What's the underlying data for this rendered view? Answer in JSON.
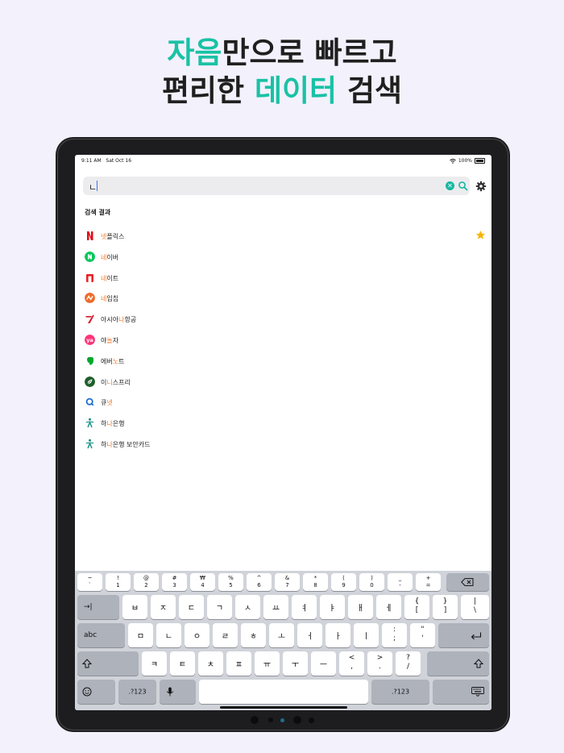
{
  "headline": {
    "line1_accent": "자음",
    "line1_rest": "만으로 빠르고",
    "line2_pre": "편리한 ",
    "line2_accent": "데이터",
    "line2_post": " 검색"
  },
  "colors": {
    "accent": "#19c2a5",
    "highlight": "#f07a2a",
    "star": "#f7b500"
  },
  "status_bar": {
    "time": "9:11 AM",
    "date": "Sat Oct 16",
    "battery": "100%"
  },
  "search": {
    "value": "ㄴ",
    "clear_icon": "clear-icon",
    "search_icon": "search-icon"
  },
  "settings_icon": "gear-icon",
  "results_title": "검색 결과",
  "results": [
    {
      "pre": "",
      "hl": "넷",
      "post": "플릭스",
      "icon": "netflix-icon",
      "starred": true
    },
    {
      "pre": "",
      "hl": "네",
      "post": "이버",
      "icon": "naver-icon"
    },
    {
      "pre": "",
      "hl": "네",
      "post": "이트",
      "icon": "nate-icon"
    },
    {
      "pre": "",
      "hl": "네",
      "post": "임칩",
      "icon": "namechip-icon"
    },
    {
      "pre": "아시아",
      "hl": "나",
      "post": "항공",
      "icon": "asiana-icon"
    },
    {
      "pre": "야",
      "hl": "놀",
      "post": "자",
      "icon": "yanolja-icon"
    },
    {
      "pre": "에버",
      "hl": "노",
      "post": "트",
      "icon": "evernote-icon"
    },
    {
      "pre": "이",
      "hl": "니",
      "post": "스프리",
      "icon": "innisfree-icon"
    },
    {
      "pre": "큐",
      "hl": "넷",
      "post": "",
      "icon": "qnet-icon"
    },
    {
      "pre": "하",
      "hl": "나",
      "post": "은행",
      "icon": "hanabank-icon"
    },
    {
      "pre": "하",
      "hl": "나",
      "post": "은행 보안카드",
      "icon": "hanabank-card-icon"
    }
  ],
  "keyboard": {
    "row1": [
      [
        "~",
        "`"
      ],
      [
        "!",
        "1"
      ],
      [
        "@",
        "2"
      ],
      [
        "#",
        "3"
      ],
      [
        "₩",
        "4"
      ],
      [
        "%",
        "5"
      ],
      [
        "^",
        "6"
      ],
      [
        "&",
        "7"
      ],
      [
        "*",
        "8"
      ],
      [
        "(",
        "9"
      ],
      [
        ")",
        "0"
      ],
      [
        "_",
        "-"
      ],
      [
        "+",
        "="
      ]
    ],
    "row2": [
      "ㅂ",
      "ㅈ",
      "ㄷ",
      "ㄱ",
      "ㅅ",
      "ㅛ",
      "ㅕ",
      "ㅑ",
      "ㅐ",
      "ㅔ"
    ],
    "row2_sym": [
      [
        "{",
        "["
      ],
      [
        "}",
        "]"
      ],
      [
        "|",
        "\\"
      ]
    ],
    "row3": [
      "ㅁ",
      "ㄴ",
      "ㅇ",
      "ㄹ",
      "ㅎ",
      "ㅗ",
      "ㅓ",
      "ㅏ",
      "ㅣ"
    ],
    "row3_sym": [
      [
        ":",
        ";"
      ],
      [
        "\"",
        "'"
      ]
    ],
    "row4": [
      "ㅋ",
      "ㅌ",
      "ㅊ",
      "ㅍ",
      "ㅠ",
      "ㅜ",
      "ㅡ"
    ],
    "row4_sym": [
      [
        "<",
        ","
      ],
      [
        ">",
        "."
      ],
      [
        "?",
        "/"
      ]
    ],
    "tab_label": "→|",
    "abc_label": "abc",
    "numbers_label": ".?123",
    "backspace_icon": "backspace-icon",
    "return_icon": "return-icon",
    "shift_icon": "shift-icon",
    "emoji_icon": "emoji-icon",
    "mic_icon": "mic-icon",
    "dismiss_icon": "keyboard-dismiss-icon"
  }
}
